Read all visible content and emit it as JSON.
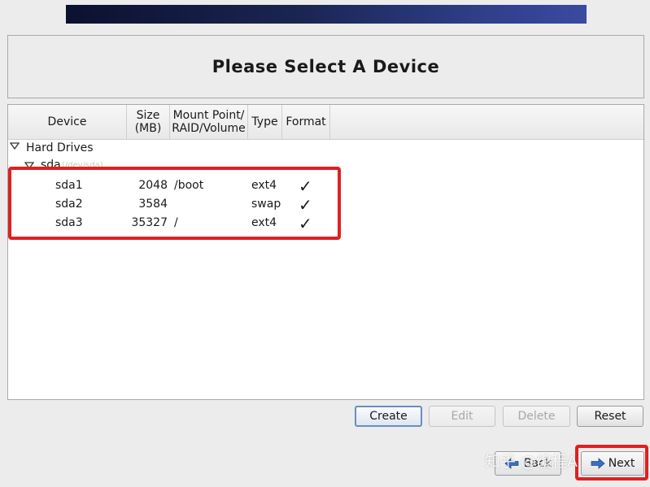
{
  "page": {
    "title": "Please Select A Device"
  },
  "columns": {
    "device": "Device",
    "size_line1": "Size",
    "size_line2": "(MB)",
    "mount_line1": "Mount Point/",
    "mount_line2": "RAID/Volume",
    "type": "Type",
    "format": "Format"
  },
  "tree": {
    "group_label": "Hard Drives",
    "disk_label": "sda",
    "disk_detail": "(/dev/sda)",
    "partitions": [
      {
        "device": "sda1",
        "size": "2048",
        "mount": "/boot",
        "type": "ext4",
        "format": "✓"
      },
      {
        "device": "sda2",
        "size": "3584",
        "mount": "",
        "type": "swap",
        "format": "✓"
      },
      {
        "device": "sda3",
        "size": "35327",
        "mount": "/",
        "type": "ext4",
        "format": "✓"
      }
    ]
  },
  "buttons": {
    "create": "Create",
    "edit": "Edit",
    "delete": "Delete",
    "reset": "Reset",
    "back": "Back",
    "next": "Next"
  },
  "watermark": "知乎 @编程A",
  "colors": {
    "highlight": "#e02020",
    "banner": "#1a2552"
  }
}
